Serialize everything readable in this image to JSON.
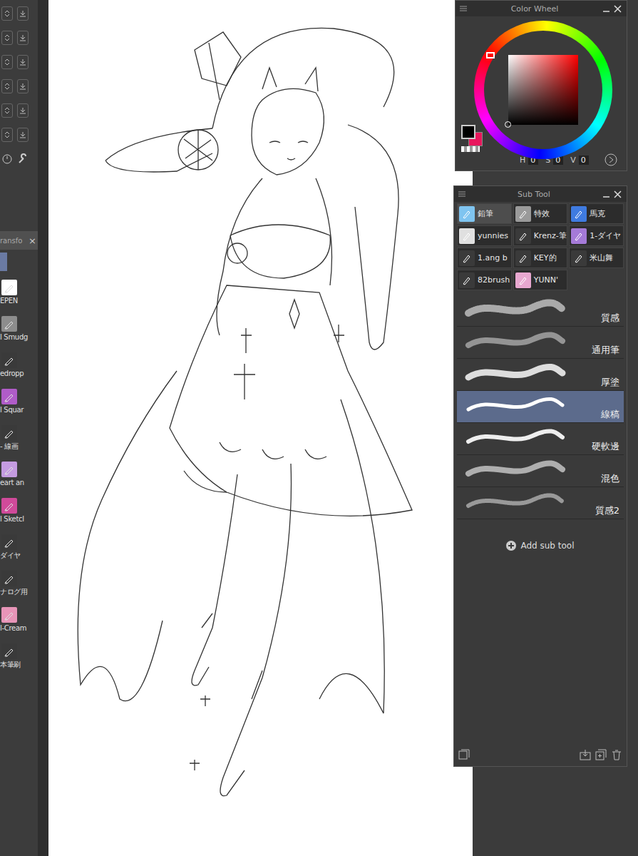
{
  "toolbar": {
    "tab": {
      "label": "ransfo",
      "close": "×"
    },
    "tools": [
      {
        "label": "EPEN",
        "color": "#ffffff"
      },
      {
        "label": "l Smudg",
        "color": "#8d8d8d"
      },
      {
        "label": "edropp",
        "color": "#3a3a3a"
      },
      {
        "label": "l Squar",
        "color": "#b05cc8"
      },
      {
        "label": "- 線画",
        "color": "#3a3a3a"
      },
      {
        "label": "eart an",
        "color": "#c49be0"
      },
      {
        "label": "l Sketcl",
        "color": "#d04a9a"
      },
      {
        "label": "ダイヤ",
        "color": "#3a3a3a"
      },
      {
        "label": "ナログ用",
        "color": "#3a3a3a"
      },
      {
        "label": "l-Cream",
        "color": "#e895b8"
      },
      {
        "label": "本筆刷",
        "color": "#3a3a3a"
      }
    ]
  },
  "color_wheel": {
    "title": "Color Wheel",
    "main_color": "#000000",
    "sub_color": "#e8175d",
    "hsv": [
      {
        "label": "H",
        "value": "0"
      },
      {
        "label": "S",
        "value": "0"
      },
      {
        "label": "V",
        "value": "0"
      }
    ]
  },
  "sub_tool": {
    "title": "Sub Tool",
    "groups": [
      {
        "label": "鉛筆",
        "selected": true,
        "color": "#7fc4f0"
      },
      {
        "label": "特效",
        "selected": false,
        "color": "#9a9a9a"
      },
      {
        "label": "馬克",
        "selected": false,
        "color": "#3f7be0"
      },
      {
        "label": "yunnies",
        "selected": false,
        "color": "#e0e0e0"
      },
      {
        "label": "Krenz-筆",
        "selected": false,
        "color": "#3a3a3a"
      },
      {
        "label": "1-ダイヤ",
        "selected": false,
        "color": "#a57ad8"
      },
      {
        "label": "1.ang b",
        "selected": false,
        "color": "#3a3a3a"
      },
      {
        "label": "KEY的",
        "selected": false,
        "color": "#3a3a3a"
      },
      {
        "label": "米山舞",
        "selected": false,
        "color": "#3a3a3a"
      },
      {
        "label": "82brush",
        "selected": false,
        "color": "#3a3a3a"
      },
      {
        "label": "YUNN'",
        "selected": false,
        "color": "#e8a8d0"
      }
    ],
    "brushes": [
      {
        "label": "質感",
        "selected": false,
        "kind": "texture"
      },
      {
        "label": "通用筆",
        "selected": false,
        "kind": "soft"
      },
      {
        "label": "厚塗",
        "selected": false,
        "kind": "paint"
      },
      {
        "label": "線稿",
        "selected": true,
        "kind": "line"
      },
      {
        "label": "硬軟邊",
        "selected": false,
        "kind": "edge"
      },
      {
        "label": "混色",
        "selected": false,
        "kind": "blend"
      },
      {
        "label": "質感2",
        "selected": false,
        "kind": "hatch"
      }
    ],
    "add": "Add sub tool"
  }
}
